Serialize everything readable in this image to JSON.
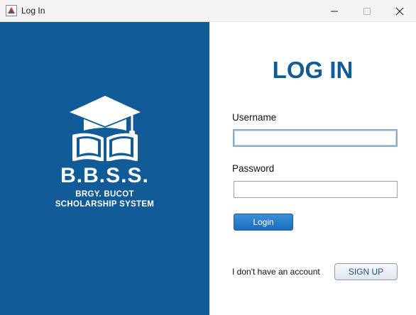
{
  "window": {
    "title": "Log In",
    "icon": "java-app-icon",
    "controls": [
      "minimize-icon",
      "maximize-icon",
      "close-icon"
    ]
  },
  "branding": {
    "logo_icon": "graduation-cap-book-icon",
    "acronym": "B.B.S.S.",
    "subtitle_line1": "BRGY. BUCOT",
    "subtitle_line2": "SCHOLARSHIP SYSTEM",
    "panel_color": "#115b98"
  },
  "form": {
    "heading": "LOG IN",
    "username_label": "Username",
    "username_value": "",
    "password_label": "Password",
    "password_value": "",
    "login_button": "Login",
    "no_account_text": "I don't have an account",
    "signup_button": "SIGN UP",
    "accent_color": "#115b98"
  }
}
